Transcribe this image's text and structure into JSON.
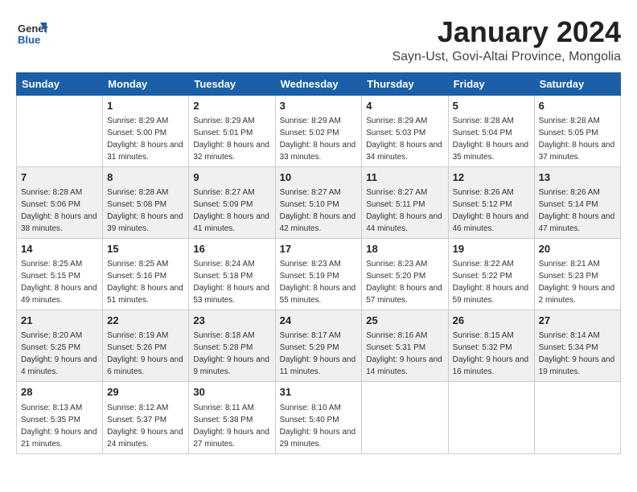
{
  "logo": {
    "general": "General",
    "blue": "Blue"
  },
  "title": "January 2024",
  "location": "Sayn-Ust, Govi-Altai Province, Mongolia",
  "days_header": [
    "Sunday",
    "Monday",
    "Tuesday",
    "Wednesday",
    "Thursday",
    "Friday",
    "Saturday"
  ],
  "weeks": [
    [
      {
        "day": "",
        "info": ""
      },
      {
        "day": "1",
        "info": "Sunrise: 8:29 AM\nSunset: 5:00 PM\nDaylight: 8 hours\nand 31 minutes."
      },
      {
        "day": "2",
        "info": "Sunrise: 8:29 AM\nSunset: 5:01 PM\nDaylight: 8 hours\nand 32 minutes."
      },
      {
        "day": "3",
        "info": "Sunrise: 8:29 AM\nSunset: 5:02 PM\nDaylight: 8 hours\nand 33 minutes."
      },
      {
        "day": "4",
        "info": "Sunrise: 8:29 AM\nSunset: 5:03 PM\nDaylight: 8 hours\nand 34 minutes."
      },
      {
        "day": "5",
        "info": "Sunrise: 8:28 AM\nSunset: 5:04 PM\nDaylight: 8 hours\nand 35 minutes."
      },
      {
        "day": "6",
        "info": "Sunrise: 8:28 AM\nSunset: 5:05 PM\nDaylight: 8 hours\nand 37 minutes."
      }
    ],
    [
      {
        "day": "7",
        "info": "Sunrise: 8:28 AM\nSunset: 5:06 PM\nDaylight: 8 hours\nand 38 minutes."
      },
      {
        "day": "8",
        "info": "Sunrise: 8:28 AM\nSunset: 5:08 PM\nDaylight: 8 hours\nand 39 minutes."
      },
      {
        "day": "9",
        "info": "Sunrise: 8:27 AM\nSunset: 5:09 PM\nDaylight: 8 hours\nand 41 minutes."
      },
      {
        "day": "10",
        "info": "Sunrise: 8:27 AM\nSunset: 5:10 PM\nDaylight: 8 hours\nand 42 minutes."
      },
      {
        "day": "11",
        "info": "Sunrise: 8:27 AM\nSunset: 5:11 PM\nDaylight: 8 hours\nand 44 minutes."
      },
      {
        "day": "12",
        "info": "Sunrise: 8:26 AM\nSunset: 5:12 PM\nDaylight: 8 hours\nand 46 minutes."
      },
      {
        "day": "13",
        "info": "Sunrise: 8:26 AM\nSunset: 5:14 PM\nDaylight: 8 hours\nand 47 minutes."
      }
    ],
    [
      {
        "day": "14",
        "info": "Sunrise: 8:25 AM\nSunset: 5:15 PM\nDaylight: 8 hours\nand 49 minutes."
      },
      {
        "day": "15",
        "info": "Sunrise: 8:25 AM\nSunset: 5:16 PM\nDaylight: 8 hours\nand 51 minutes."
      },
      {
        "day": "16",
        "info": "Sunrise: 8:24 AM\nSunset: 5:18 PM\nDaylight: 8 hours\nand 53 minutes."
      },
      {
        "day": "17",
        "info": "Sunrise: 8:23 AM\nSunset: 5:19 PM\nDaylight: 8 hours\nand 55 minutes."
      },
      {
        "day": "18",
        "info": "Sunrise: 8:23 AM\nSunset: 5:20 PM\nDaylight: 8 hours\nand 57 minutes."
      },
      {
        "day": "19",
        "info": "Sunrise: 8:22 AM\nSunset: 5:22 PM\nDaylight: 8 hours\nand 59 minutes."
      },
      {
        "day": "20",
        "info": "Sunrise: 8:21 AM\nSunset: 5:23 PM\nDaylight: 9 hours\nand 2 minutes."
      }
    ],
    [
      {
        "day": "21",
        "info": "Sunrise: 8:20 AM\nSunset: 5:25 PM\nDaylight: 9 hours\nand 4 minutes."
      },
      {
        "day": "22",
        "info": "Sunrise: 8:19 AM\nSunset: 5:26 PM\nDaylight: 9 hours\nand 6 minutes."
      },
      {
        "day": "23",
        "info": "Sunrise: 8:18 AM\nSunset: 5:28 PM\nDaylight: 9 hours\nand 9 minutes."
      },
      {
        "day": "24",
        "info": "Sunrise: 8:17 AM\nSunset: 5:29 PM\nDaylight: 9 hours\nand 11 minutes."
      },
      {
        "day": "25",
        "info": "Sunrise: 8:16 AM\nSunset: 5:31 PM\nDaylight: 9 hours\nand 14 minutes."
      },
      {
        "day": "26",
        "info": "Sunrise: 8:15 AM\nSunset: 5:32 PM\nDaylight: 9 hours\nand 16 minutes."
      },
      {
        "day": "27",
        "info": "Sunrise: 8:14 AM\nSunset: 5:34 PM\nDaylight: 9 hours\nand 19 minutes."
      }
    ],
    [
      {
        "day": "28",
        "info": "Sunrise: 8:13 AM\nSunset: 5:35 PM\nDaylight: 9 hours\nand 21 minutes."
      },
      {
        "day": "29",
        "info": "Sunrise: 8:12 AM\nSunset: 5:37 PM\nDaylight: 9 hours\nand 24 minutes."
      },
      {
        "day": "30",
        "info": "Sunrise: 8:11 AM\nSunset: 5:38 PM\nDaylight: 9 hours\nand 27 minutes."
      },
      {
        "day": "31",
        "info": "Sunrise: 8:10 AM\nSunset: 5:40 PM\nDaylight: 9 hours\nand 29 minutes."
      },
      {
        "day": "",
        "info": ""
      },
      {
        "day": "",
        "info": ""
      },
      {
        "day": "",
        "info": ""
      }
    ]
  ]
}
